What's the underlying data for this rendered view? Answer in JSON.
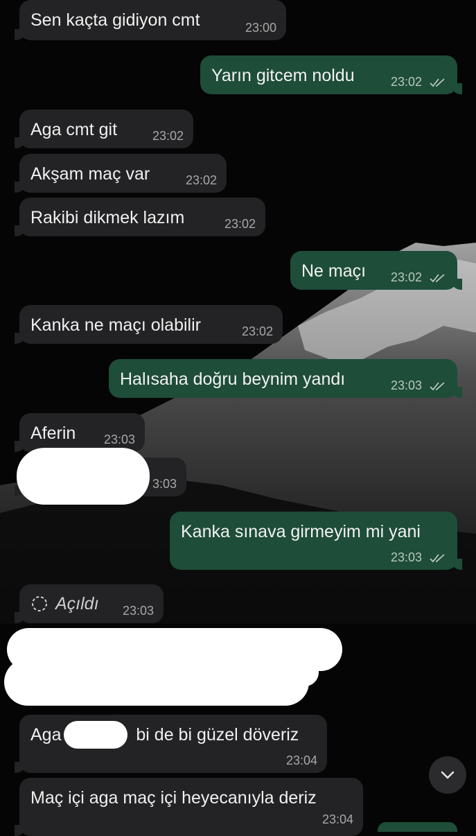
{
  "messages": [
    {
      "text": "Sen kaçta gidiyon cmt",
      "time": "23:00"
    },
    {
      "text": "Yarın gitcem noldu",
      "time": "23:02"
    },
    {
      "text": "Aga cmt git",
      "time": "23:02"
    },
    {
      "text": "Akşam maç var",
      "time": "23:02"
    },
    {
      "text": "Rakibi dikmek lazım",
      "time": "23:02"
    },
    {
      "text": "Ne maçı",
      "time": "23:02"
    },
    {
      "text": "Kanka ne maçı olabilir",
      "time": "23:02"
    },
    {
      "text": "Halısaha doğru beynim yandı",
      "time": "23:03"
    },
    {
      "text": "Aferin",
      "time": "23:03"
    },
    {
      "text": "",
      "time": "3:03"
    },
    {
      "text": "Kanka sınava girmeyim mi yani",
      "time": "23:03"
    },
    {
      "text": "Açıldı",
      "time": "23:03"
    },
    {
      "text_start": "Aga",
      "text_end": "bi de bi güzel döveriz",
      "time": "23:04"
    },
    {
      "text": "Maç içi aga maç içi heyecanıyla deriz",
      "time": "23:04"
    }
  ],
  "colors": {
    "incoming_bubble": "#232325",
    "outgoing_bubble": "#1e4d39",
    "background": "#050505"
  },
  "icons": {
    "read_receipt": "double-check-icon",
    "view_once": "view-once-opened-icon",
    "scroll_down": "chevron-down-icon"
  }
}
